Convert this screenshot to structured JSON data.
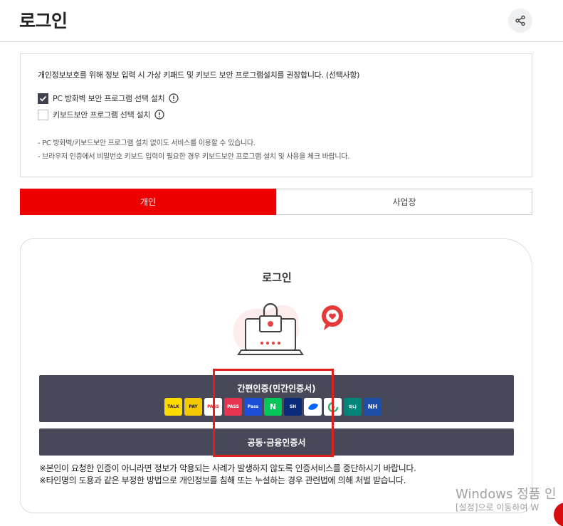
{
  "header": {
    "title": "로그인",
    "share_icon": "share-icon"
  },
  "security": {
    "description": "개인정보보호를 위해 정보 입력 시 가상 키패드 및 키보드 보안 프로그램설치를 권장합니다. (선택사항)",
    "options": [
      {
        "label": "PC 방화벽 보안 프로그램 선택 설치",
        "checked": true
      },
      {
        "label": "키보드보안 프로그램 선택 설치",
        "checked": false
      }
    ],
    "notes": [
      "- PC 방화벽/키보드보안 프로그램 설치 없이도 서비스를 이용할 수 있습니다.",
      "- 브라우저 인증에서 비밀번호 키보드 입력이 필요한 경우 키보드보안 프로그램 설치 및 사용을 체크 바랍니다."
    ]
  },
  "tabs": [
    {
      "label": "개인",
      "active": true
    },
    {
      "label": "사업장",
      "active": false
    }
  ],
  "login": {
    "title": "로그인",
    "illustration": "laptop-lock-illustration",
    "simple_auth_label": "간편인증(민간인증서)",
    "providers": [
      {
        "name": "kakaotalk",
        "text": "TALK",
        "bg": "#ffdc00",
        "fg": "#3a1d1d"
      },
      {
        "name": "payco",
        "text": "PAY",
        "bg": "#f5c800",
        "fg": "#222222"
      },
      {
        "name": "samsung-pass",
        "text": "PASS",
        "bg": "#ffffff",
        "fg": "#e52828"
      },
      {
        "name": "pass",
        "text": "PASS",
        "bg": "#e8344e",
        "fg": "#ffffff"
      },
      {
        "name": "samsung",
        "text": "Pass",
        "bg": "#1c4ed8",
        "fg": "#ffffff"
      },
      {
        "name": "naver",
        "text": "N",
        "bg": "#03c75a",
        "fg": "#ffffff"
      },
      {
        "name": "shinhan",
        "text": "SH",
        "bg": "#0a2a7a",
        "fg": "#ffffff"
      },
      {
        "name": "toss",
        "text": "",
        "bg": "#ffffff",
        "fg": "#0064ff"
      },
      {
        "name": "bank-salad",
        "text": "",
        "bg": "#ffffff",
        "fg": "#1fb86a"
      },
      {
        "name": "hana",
        "text": "하나",
        "bg": "#00857a",
        "fg": "#ffffff"
      },
      {
        "name": "nh",
        "text": "NH",
        "bg": "#1d4fa8",
        "fg": "#ffffff"
      }
    ],
    "cert_button": "공동·금융인증서",
    "warnings": [
      "※본인이 요청한 인증이 아니라면 정보가 악용되는 사례가 발생하지 않도록 인증서비스를 중단하시기 바랍니다.",
      "※타인명의 도용과 같은 부정한 방법으로 개인정보를 침해 또는 누설하는 경우 관련법에 의해 처벌 받습니다."
    ]
  },
  "watermark": {
    "line1": "Windows 정품 인",
    "line2": "[설정]으로 이동하여 W"
  },
  "colors": {
    "accent": "#ee0000",
    "button_dark": "#474958",
    "highlight": "#e01f1f"
  }
}
